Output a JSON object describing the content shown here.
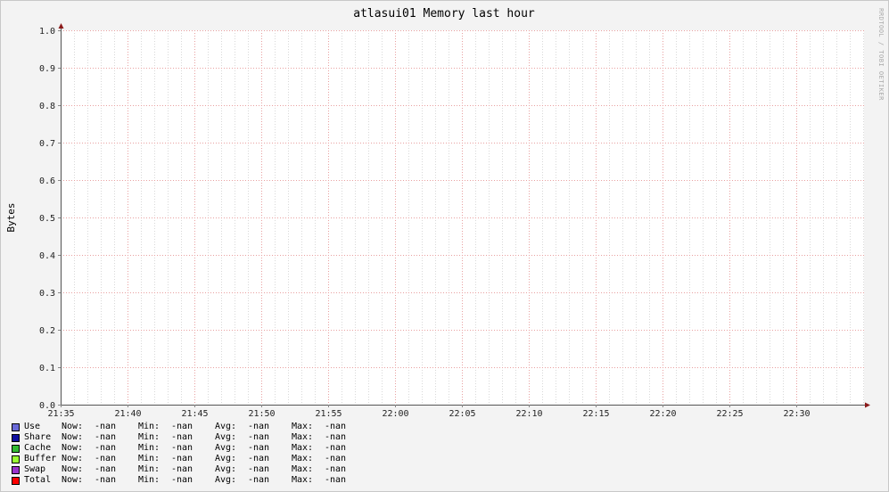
{
  "chart_data": {
    "type": "area",
    "title": "atlasui01 Memory last hour",
    "ylabel": "Bytes",
    "xlabel": "",
    "watermark": "RRDTOOL / TOBI OETIKER",
    "ylim": [
      0,
      1.0
    ],
    "y_ticks": [
      "0.0",
      "0.1",
      "0.2",
      "0.3",
      "0.4",
      "0.5",
      "0.6",
      "0.7",
      "0.8",
      "0.9",
      "1.0"
    ],
    "x_ticks": [
      "21:35",
      "21:40",
      "21:45",
      "21:50",
      "21:55",
      "22:00",
      "22:05",
      "22:10",
      "22:15",
      "22:20",
      "22:25",
      "22:30"
    ],
    "grid": true,
    "series": [
      {
        "name": "Use",
        "color": "#6a6ad8",
        "values": []
      },
      {
        "name": "Share",
        "color": "#1010a0",
        "values": []
      },
      {
        "name": "Cache",
        "color": "#33bb33",
        "values": []
      },
      {
        "name": "Buffer",
        "color": "#99ff33",
        "values": []
      },
      {
        "name": "Swap",
        "color": "#9933cc",
        "values": []
      },
      {
        "name": "Total",
        "color": "#ff0000",
        "values": []
      }
    ]
  },
  "legend": {
    "labels": {
      "now": "Now:",
      "min": "Min:",
      "avg": "Avg:",
      "max": "Max:"
    },
    "rows": [
      {
        "name": "Use",
        "color": "#6a6ad8",
        "now": "-nan",
        "min": "-nan",
        "avg": "-nan",
        "max": "-nan"
      },
      {
        "name": "Share",
        "color": "#1010a0",
        "now": "-nan",
        "min": "-nan",
        "avg": "-nan",
        "max": "-nan"
      },
      {
        "name": "Cache",
        "color": "#33bb33",
        "now": "-nan",
        "min": "-nan",
        "avg": "-nan",
        "max": "-nan"
      },
      {
        "name": "Buffer",
        "color": "#99ff33",
        "now": "-nan",
        "min": "-nan",
        "avg": "-nan",
        "max": "-nan"
      },
      {
        "name": "Swap",
        "color": "#9933cc",
        "now": "-nan",
        "min": "-nan",
        "avg": "-nan",
        "max": "-nan"
      },
      {
        "name": "Total",
        "color": "#ff0000",
        "now": "-nan",
        "min": "-nan",
        "avg": "-nan",
        "max": "-nan"
      }
    ]
  }
}
